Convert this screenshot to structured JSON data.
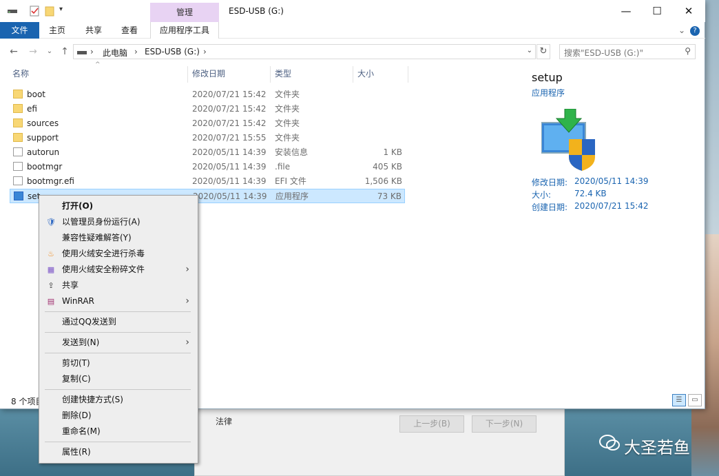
{
  "window": {
    "title": "ESD-USB (G:)",
    "context_group": "管理"
  },
  "ribbon": {
    "tabs": [
      "文件",
      "主页",
      "共享",
      "查看"
    ],
    "app_tools_tab": "应用程序工具"
  },
  "address": {
    "crumbs": [
      "此电脑",
      "ESD-USB (G:)"
    ],
    "search_placeholder": "搜索\"ESD-USB (G:)\""
  },
  "columns": {
    "name": "名称",
    "date": "修改日期",
    "type": "类型",
    "size": "大小"
  },
  "files": [
    {
      "name": "boot",
      "date": "2020/07/21 15:42",
      "type": "文件夹",
      "size": "",
      "icon": "folder-icon"
    },
    {
      "name": "efi",
      "date": "2020/07/21 15:42",
      "type": "文件夹",
      "size": "",
      "icon": "folder-icon"
    },
    {
      "name": "sources",
      "date": "2020/07/21 15:42",
      "type": "文件夹",
      "size": "",
      "icon": "folder-icon"
    },
    {
      "name": "support",
      "date": "2020/07/21 15:55",
      "type": "文件夹",
      "size": "",
      "icon": "folder-icon"
    },
    {
      "name": "autorun",
      "date": "2020/05/11 14:39",
      "type": "安装信息",
      "size": "1 KB",
      "icon": "settings-file-icon"
    },
    {
      "name": "bootmgr",
      "date": "2020/05/11 14:39",
      "type": ".file",
      "size": "405 KB",
      "icon": "file-icon"
    },
    {
      "name": "bootmgr.efi",
      "date": "2020/05/11 14:39",
      "type": "EFI 文件",
      "size": "1,506 KB",
      "icon": "file-icon"
    },
    {
      "name": "set",
      "date": "2020/05/11 14:39",
      "type": "应用程序",
      "size": "73 KB",
      "icon": "setup-icon",
      "selected": true
    }
  ],
  "preview": {
    "title": "setup",
    "subtitle": "应用程序",
    "fields": [
      {
        "label": "修改日期:",
        "value": "2020/05/11 14:39"
      },
      {
        "label": "大小:",
        "value": "72.4 KB"
      },
      {
        "label": "创建日期:",
        "value": "2020/07/21 15:42"
      }
    ]
  },
  "status": {
    "count": "8 个项目"
  },
  "context_menu": {
    "items": [
      {
        "label": "打开(O)",
        "bold": true,
        "icon": ""
      },
      {
        "label": "以管理员身份运行(A)",
        "icon": "shield-icon"
      },
      {
        "label": "兼容性疑难解答(Y)",
        "icon": ""
      },
      {
        "label": "使用火绒安全进行杀毒",
        "icon": "huorong-icon"
      },
      {
        "label": "使用火绒安全粉碎文件",
        "icon": "shredder-icon",
        "submenu": true
      },
      {
        "label": "共享",
        "icon": "share-icon"
      },
      {
        "label": "WinRAR",
        "icon": "winrar-icon",
        "submenu": true
      },
      {
        "label": "通过QQ发送到",
        "icon": ""
      },
      {
        "label": "发送到(N)",
        "icon": "",
        "submenu": true
      },
      {
        "label": "剪切(T)",
        "icon": ""
      },
      {
        "label": "复制(C)",
        "icon": ""
      },
      {
        "label": "创建快捷方式(S)",
        "icon": ""
      },
      {
        "label": "删除(D)",
        "icon": ""
      },
      {
        "label": "重命名(M)",
        "icon": ""
      },
      {
        "label": "属性(R)",
        "icon": ""
      }
    ]
  },
  "behind_dialog": {
    "law_label": "法律",
    "back_label": "上一步(B)",
    "next_label": "下一步(N)"
  },
  "watermark": {
    "text": "大圣若鱼"
  }
}
